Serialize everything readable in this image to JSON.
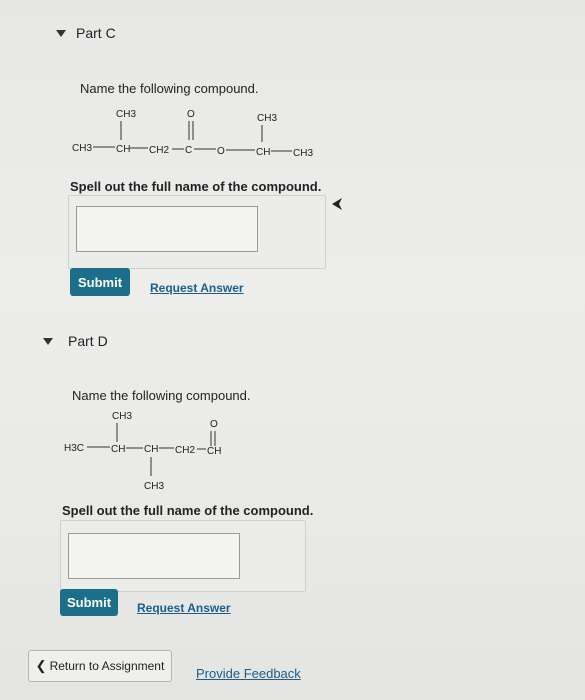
{
  "part_c": {
    "title": "Part C",
    "prompt": "Name the following compound.",
    "instruction": "Spell out the full name of the compound.",
    "submit_label": "Submit",
    "request_answer_label": "Request Answer",
    "answer_value": "",
    "structure": {
      "ch3_left": "CH3",
      "ch_1": "CH",
      "ch2": "CH2",
      "c": "C",
      "o_carbonyl": "O",
      "o_ester": "O",
      "ch_2": "CH",
      "ch3_right": "CH3",
      "ch3_top_left": "CH3",
      "ch3_top_right": "CH3"
    }
  },
  "part_d": {
    "title": "Part D",
    "prompt": "Name the following compound.",
    "instruction": "Spell out the full name of the compound.",
    "submit_label": "Submit",
    "request_answer_label": "Request Answer",
    "answer_value": "",
    "structure": {
      "h3c": "H3C",
      "ch_1": "CH",
      "ch_2": "CH",
      "ch2": "CH2",
      "ch_end": "CH",
      "o_carbonyl": "O",
      "ch3_top": "CH3",
      "ch3_bottom": "CH3"
    }
  },
  "footer": {
    "return_label": "Return to Assignment",
    "feedback_label": "Provide Feedback"
  }
}
